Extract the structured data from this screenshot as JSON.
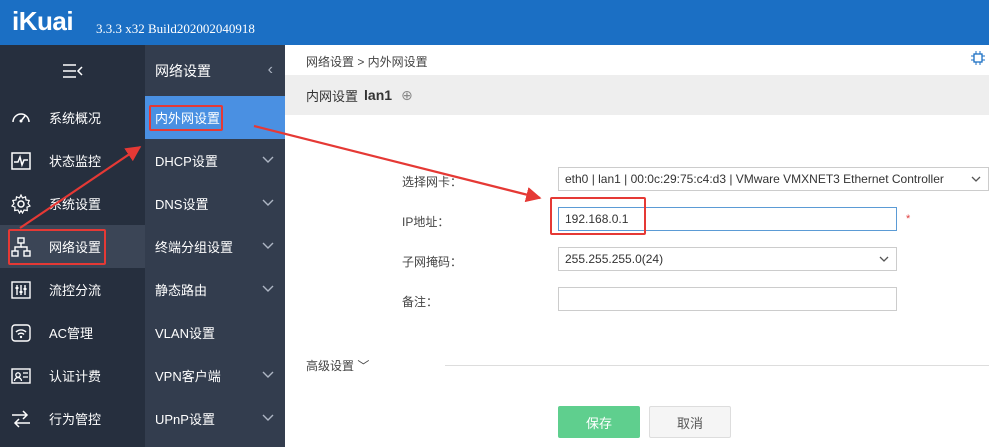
{
  "app": {
    "logo": "iKuai",
    "version": "3.3.3 x32 Build202002040918"
  },
  "sidebar": {
    "toggle_icon": "menu-collapse-icon",
    "items": [
      {
        "label": "系统概况",
        "icon": "dashboard-gauge-icon"
      },
      {
        "label": "状态监控",
        "icon": "heartbeat-monitor-icon"
      },
      {
        "label": "系统设置",
        "icon": "gear-icon"
      },
      {
        "label": "网络设置",
        "icon": "network-topology-icon",
        "active": true
      },
      {
        "label": "流控分流",
        "icon": "sliders-icon"
      },
      {
        "label": "AC管理",
        "icon": "wifi-icon"
      },
      {
        "label": "认证计费",
        "icon": "id-card-icon"
      },
      {
        "label": "行为管控",
        "icon": "arrows-control-icon"
      }
    ]
  },
  "subnav": {
    "title": "网络设置",
    "collapse_glyph": "‹",
    "items": [
      {
        "label": "内外网设置",
        "active": true
      },
      {
        "label": "DHCP设置",
        "expandable": true
      },
      {
        "label": "DNS设置",
        "expandable": true
      },
      {
        "label": "终端分组设置",
        "expandable": true
      },
      {
        "label": "静态路由",
        "expandable": true
      },
      {
        "label": "VLAN设置",
        "expandable": false
      },
      {
        "label": "VPN客户端",
        "expandable": true
      },
      {
        "label": "UPnP设置",
        "expandable": true
      }
    ]
  },
  "main": {
    "breadcrumb": "网络设置 > 内外网设置",
    "title_prefix": "内网设置",
    "title_iface": "lan1",
    "add_glyph": "⊕",
    "form": {
      "nic_label": "选择网卡：",
      "nic_value": "eth0 | lan1 | 00:0c:29:75:c4:d3 | VMware VMXNET3 Ethernet Controller",
      "ip_label": "IP地址：",
      "ip_value": "192.168.0.1",
      "required_mark": "*",
      "mask_label": "子网掩码：",
      "mask_value": "255.255.255.0(24)",
      "note_label": "备注：",
      "note_value": ""
    },
    "advanced_label": "高级设置 ﹀",
    "save_label": "保存",
    "cancel_label": "取消"
  },
  "colors": {
    "topbar": "#1b6fc4",
    "sidebar": "#262f3e",
    "subnav": "#333d4e",
    "subnav_active": "#4a90e2",
    "save_button": "#5fcf8e",
    "annotation": "#e53935"
  }
}
